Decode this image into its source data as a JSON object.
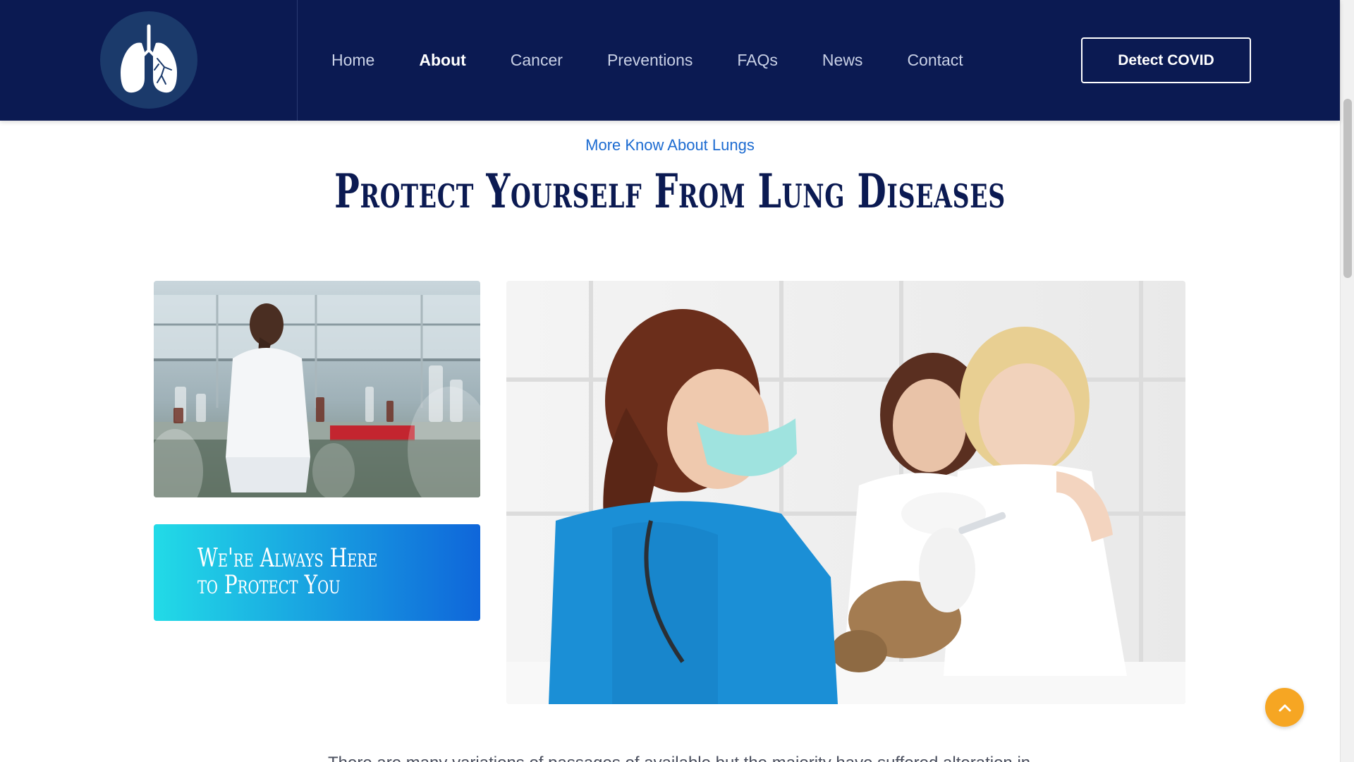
{
  "header": {
    "logo_icon": "lungs-icon",
    "nav": [
      {
        "label": "Home",
        "active": false
      },
      {
        "label": "About",
        "active": true
      },
      {
        "label": "Cancer",
        "active": false
      },
      {
        "label": "Preventions",
        "active": false
      },
      {
        "label": "FAQs",
        "active": false
      },
      {
        "label": "News",
        "active": false
      },
      {
        "label": "Contact",
        "active": false
      }
    ],
    "cta_label": "Detect COVID"
  },
  "section": {
    "eyebrow": "More Know About Lungs",
    "title": "Protect Yourself From Lung Diseases"
  },
  "card": {
    "text": "We're Always Here to Protect You"
  },
  "paragraph_partial": "There are many variations of passages of available but the majority have suffered alteration in",
  "scroll_top_icon": "chevron-up-icon",
  "colors": {
    "header_bg": "#0b1a52",
    "accent_blue": "#1c6bd1",
    "card_gradient_start": "#22dbe7",
    "card_gradient_end": "#0f66da",
    "scroll_top_bg": "#f6a623"
  }
}
